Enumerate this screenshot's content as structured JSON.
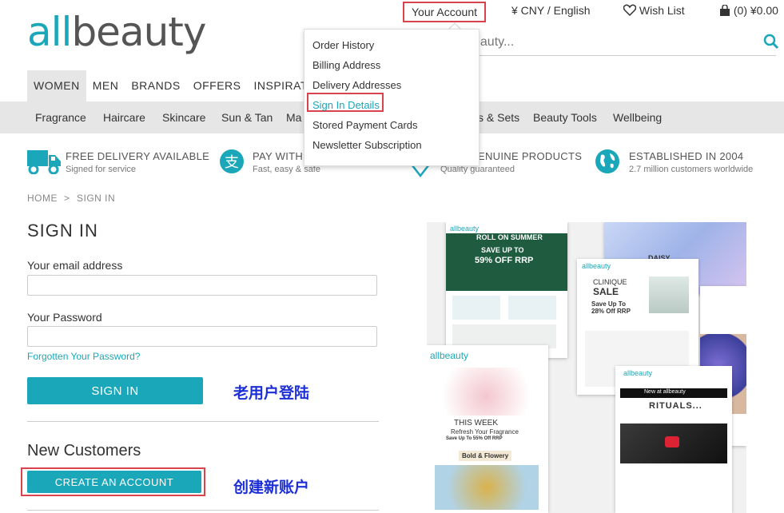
{
  "brand": {
    "logo_a": "all",
    "logo_b": "beauty",
    "teal": "#1aa7b9",
    "highlight": "#d9434c"
  },
  "header": {
    "your_account": "Your Account",
    "currency": "¥ CNY / English",
    "wishlist": "Wish List",
    "basket": "(0) ¥0.00",
    "search_placeholder": "eauty..."
  },
  "account_menu": {
    "items": [
      "Order History",
      "Billing Address",
      "Delivery Addresses",
      "Sign In Details",
      "Stored Payment Cards",
      "Newsletter Subscription"
    ],
    "highlighted": "Sign In Details"
  },
  "main_nav": [
    "WOMEN",
    "MEN",
    "BRANDS",
    "OFFERS",
    "INSPIRATI"
  ],
  "sub_nav": [
    "Fragrance",
    "Haircare",
    "Skincare",
    "Sun & Tan",
    "Ma",
    "s & Sets",
    "Beauty Tools",
    "Wellbeing"
  ],
  "features": [
    {
      "title": "FREE DELIVERY AVAILABLE",
      "sub": "Signed for service"
    },
    {
      "title": "PAY WITH A",
      "sub": "Fast, easy & safe"
    },
    {
      "title": "ENUINE PRODUCTS",
      "sub": "Quality guaranteed"
    },
    {
      "title": "ESTABLISHED IN 2004",
      "sub": "2.7 million customers worldwide"
    }
  ],
  "breadcrumb": {
    "home": "HOME",
    "sep": ">",
    "current": "SIGN IN"
  },
  "sign_in": {
    "title": "SIGN IN",
    "email_label": "Your email address",
    "password_label": "Your Password",
    "forgot": "Forgotten Your Password?",
    "button": "SIGN IN",
    "annotation": "老用户登陆"
  },
  "new_customers": {
    "title": "New Customers",
    "button": "CREATE AN ACCOUNT",
    "annotation": "创建新账户"
  },
  "promo": {
    "card1_logo": "allbeauty",
    "card1_head": "ROLL ON SUMMER",
    "card1_save": "SAVE UP TO",
    "card1_off": "59% OFF RRP",
    "card2_logo": "allbeauty",
    "card2_brand": "CLINIQUE",
    "card2_sale": "SALE",
    "card2_save": "Save Up To",
    "card2_off": "28% Off RRP",
    "card3_logo": "allbeauty",
    "card3_week": "THIS WEEK",
    "card3_refresh": "Refresh Your Fragrance",
    "card3_save": "Save Up To 55% Off RRP",
    "card3_bold": "Bold & Flowery",
    "card4_logo": "allbeauty",
    "card4_new": "New at allbeauty",
    "card4_rituals": "RITUALS...",
    "card5_daisy": "DAISY"
  }
}
